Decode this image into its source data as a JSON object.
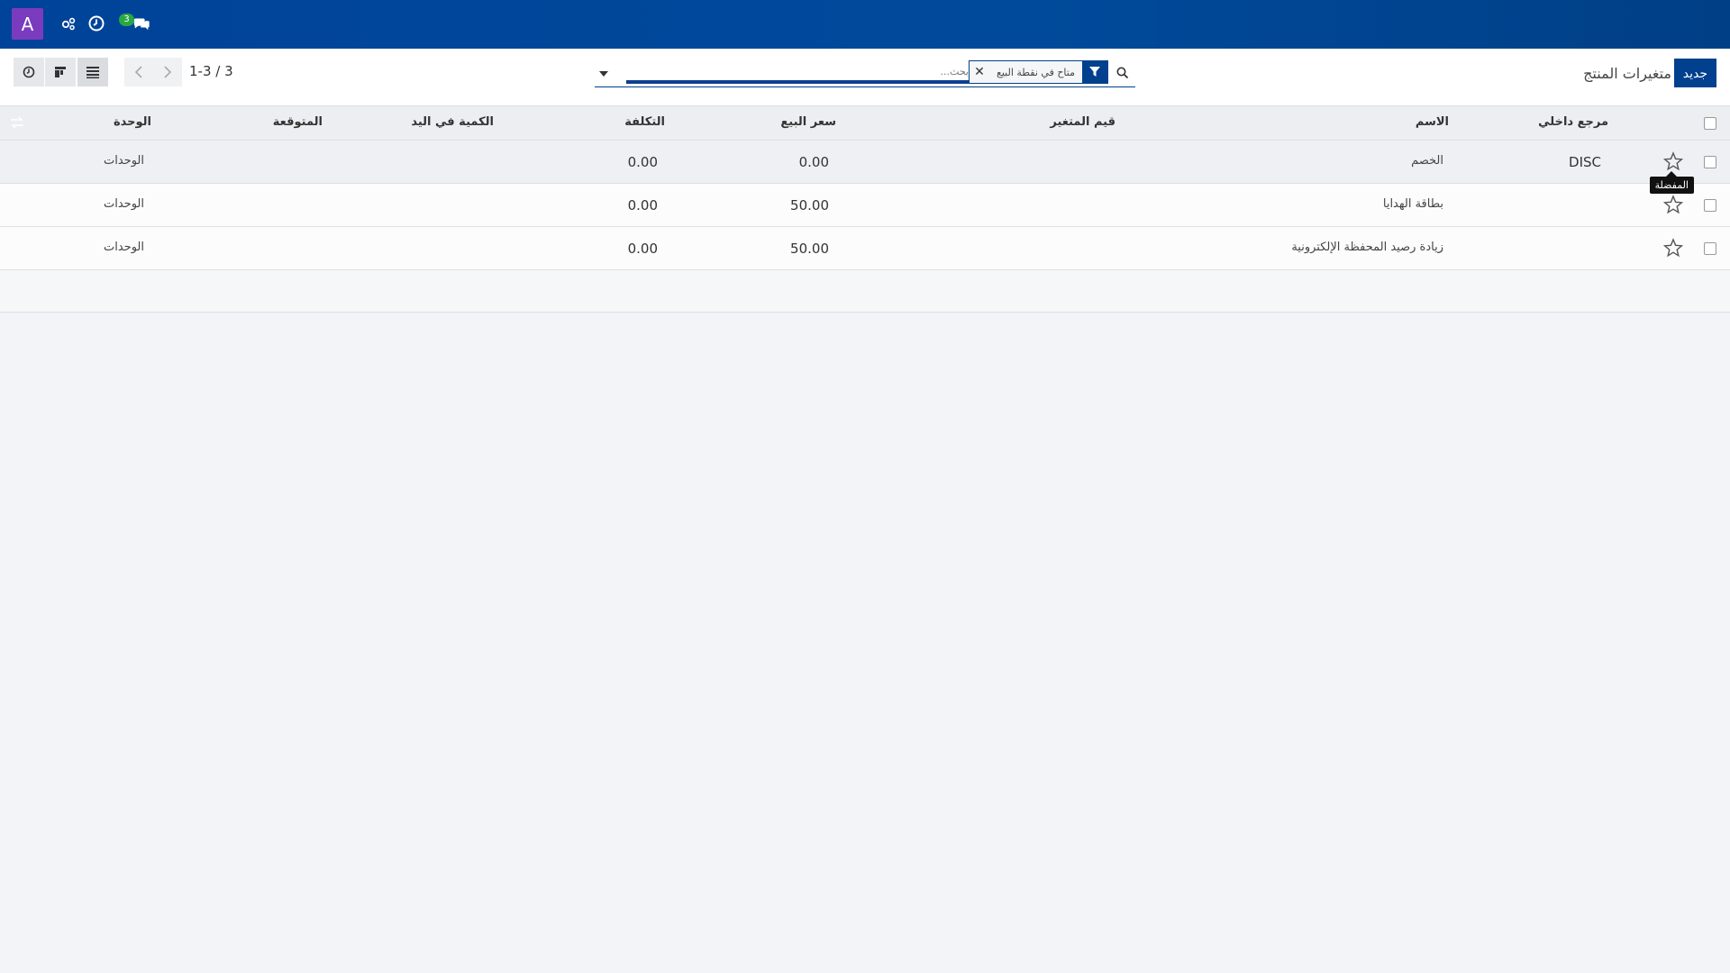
{
  "navbar": {
    "avatar_letter": "A",
    "messages_badge": "3",
    "icons": [
      "avatar",
      "activity-icon",
      "clock-icon",
      "messages-icon"
    ]
  },
  "control_panel": {
    "new_button": "جديد",
    "breadcrumb": "متغيرات المنتج",
    "search": {
      "facet_label": "متاح في نقطة البيع",
      "placeholder": "بحث..."
    },
    "pager": "1-3 / 3"
  },
  "table": {
    "columns": [
      "مرجع داخلي",
      "الاسم",
      "قيم المتغير",
      "سعر البيع",
      "التكلفة",
      "الكمية في اليد",
      "المتوقعة",
      "الوحدة"
    ],
    "rows": [
      {
        "ref": "DISC",
        "name": "الخصم",
        "variant_values": "",
        "sale_price": "0.00",
        "cost": "0.00",
        "qty_on_hand": "",
        "forecast": "",
        "uom": "الوحدات"
      },
      {
        "ref": "",
        "name": "بطاقة الهدايا",
        "variant_values": "",
        "sale_price": "50.00",
        "cost": "0.00",
        "qty_on_hand": "",
        "forecast": "",
        "uom": "الوحدات"
      },
      {
        "ref": "",
        "name": "زيادة رصيد المحفظة الإلكترونية",
        "variant_values": "",
        "sale_price": "50.00",
        "cost": "0.00",
        "qty_on_hand": "",
        "forecast": "",
        "uom": "الوحدات"
      }
    ]
  },
  "tooltip": "المفضلة",
  "colors": {
    "primary": "#00408e",
    "navbar": "#00439a",
    "badge": "#28a745",
    "avatar": "#7a3bbf"
  }
}
